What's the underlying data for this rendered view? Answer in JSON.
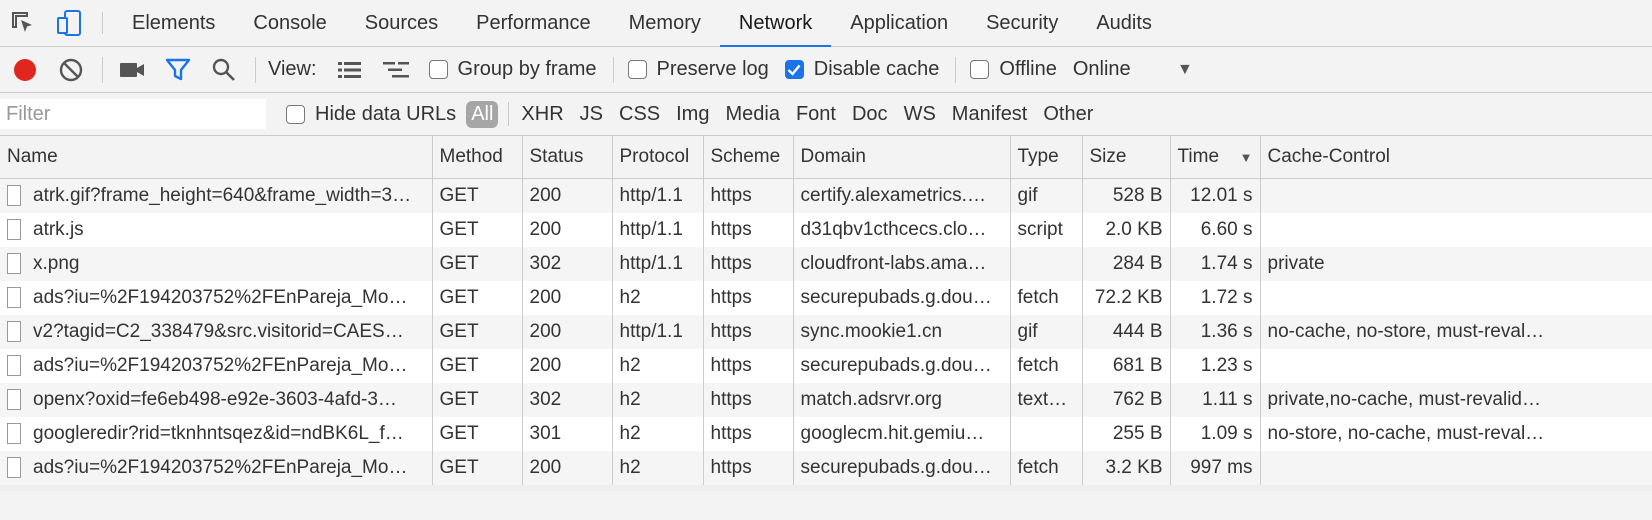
{
  "tabs": [
    {
      "label": "Elements"
    },
    {
      "label": "Console"
    },
    {
      "label": "Sources"
    },
    {
      "label": "Performance"
    },
    {
      "label": "Memory"
    },
    {
      "label": "Network"
    },
    {
      "label": "Application"
    },
    {
      "label": "Security"
    },
    {
      "label": "Audits"
    }
  ],
  "active_tab": "Network",
  "toolbar": {
    "view_label": "View:",
    "group_by_frame": "Group by frame",
    "preserve_log": "Preserve log",
    "disable_cache": "Disable cache",
    "offline": "Offline",
    "throttle": "Online",
    "disable_cache_checked": true,
    "record_color": "#e0271f"
  },
  "filterbar": {
    "placeholder": "Filter",
    "hide_data_urls": "Hide data URLs",
    "types": [
      "All",
      "XHR",
      "JS",
      "CSS",
      "Img",
      "Media",
      "Font",
      "Doc",
      "WS",
      "Manifest",
      "Other"
    ]
  },
  "columns": [
    "Name",
    "Method",
    "Status",
    "Protocol",
    "Scheme",
    "Domain",
    "Type",
    "Size",
    "Time",
    "Cache-Control"
  ],
  "rows": [
    [
      "atrk.gif?frame_height=640&frame_width=3…",
      "GET",
      "200",
      "http/1.1",
      "https",
      "certify.alexametrics.…",
      "gif",
      "528 B",
      "12.01 s",
      ""
    ],
    [
      "atrk.js",
      "GET",
      "200",
      "http/1.1",
      "https",
      "d31qbv1cthcecs.clo…",
      "script",
      "2.0 KB",
      "6.60 s",
      ""
    ],
    [
      "x.png",
      "GET",
      "302",
      "http/1.1",
      "https",
      "cloudfront-labs.ama…",
      "",
      "284 B",
      "1.74 s",
      "private"
    ],
    [
      "ads?iu=%2F194203752%2FEnPareja_Mo…",
      "GET",
      "200",
      "h2",
      "https",
      "securepubads.g.dou…",
      "fetch",
      "72.2 KB",
      "1.72 s",
      ""
    ],
    [
      "v2?tagid=C2_338479&src.visitorid=CAES…",
      "GET",
      "200",
      "http/1.1",
      "https",
      "sync.mookie1.cn",
      "gif",
      "444 B",
      "1.36 s",
      "no-cache, no-store, must-reval…"
    ],
    [
      "ads?iu=%2F194203752%2FEnPareja_Mo…",
      "GET",
      "200",
      "h2",
      "https",
      "securepubads.g.dou…",
      "fetch",
      "681 B",
      "1.23 s",
      ""
    ],
    [
      "openx?oxid=fe6eb498-e92e-3603-4afd-3…",
      "GET",
      "302",
      "h2",
      "https",
      "match.adsrvr.org",
      "text…",
      "762 B",
      "1.11 s",
      "private,no-cache, must-revalid…"
    ],
    [
      "googleredir?rid=tknhntsqez&id=ndBK6L_f…",
      "GET",
      "301",
      "h2",
      "https",
      "googlecm.hit.gemiu…",
      "",
      "255 B",
      "1.09 s",
      "no-store, no-cache, must-reval…"
    ],
    [
      "ads?iu=%2F194203752%2FEnPareja_Mo…",
      "GET",
      "200",
      "h2",
      "https",
      "securepubads.g.dou…",
      "fetch",
      "3.2 KB",
      "997 ms",
      ""
    ]
  ]
}
